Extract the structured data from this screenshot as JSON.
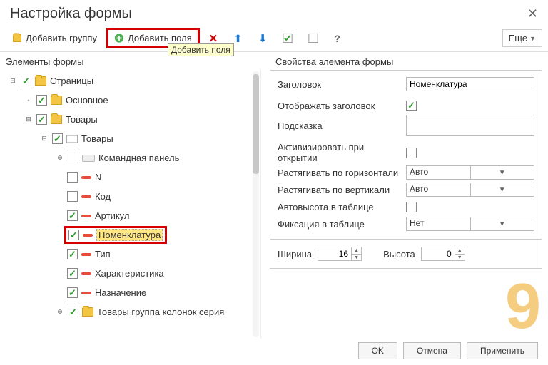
{
  "title": "Настройка формы",
  "toolbar": {
    "add_group": "Добавить группу",
    "add_fields": "Добавить поля",
    "more": "Еще",
    "tooltip": "Добавить поля"
  },
  "panes": {
    "left_title": "Элементы формы",
    "right_title": "Свойства элемента формы"
  },
  "tree": {
    "pages": "Страницы",
    "main": "Основное",
    "goods": "Товары",
    "goods_table": "Товары",
    "cmd_panel": "Командная панель",
    "n": "N",
    "code": "Код",
    "article": "Артикул",
    "nomenclature": "Номенклатура",
    "type": "Тип",
    "characteristic": "Характеристика",
    "purpose": "Назначение",
    "goods_group": "Товары группа колонок серия"
  },
  "props": {
    "header_label": "Заголовок",
    "header_value": "Номенклатура",
    "show_header": "Отображать заголовок",
    "show_header_on": true,
    "hint": "Подсказка",
    "activate_on_open": "Активизировать при открытии",
    "stretch_h": "Растягивать по горизонтали",
    "stretch_h_value": "Авто",
    "stretch_v": "Растягивать по вертикали",
    "stretch_v_value": "Авто",
    "autoheight": "Автовысота в таблице",
    "fixation": "Фиксация в таблице",
    "fixation_value": "Нет",
    "width_label": "Ширина",
    "width_value": "16",
    "height_label": "Высота",
    "height_value": "0"
  },
  "footer": {
    "ok": "OK",
    "cancel": "Отмена",
    "apply": "Применить"
  }
}
